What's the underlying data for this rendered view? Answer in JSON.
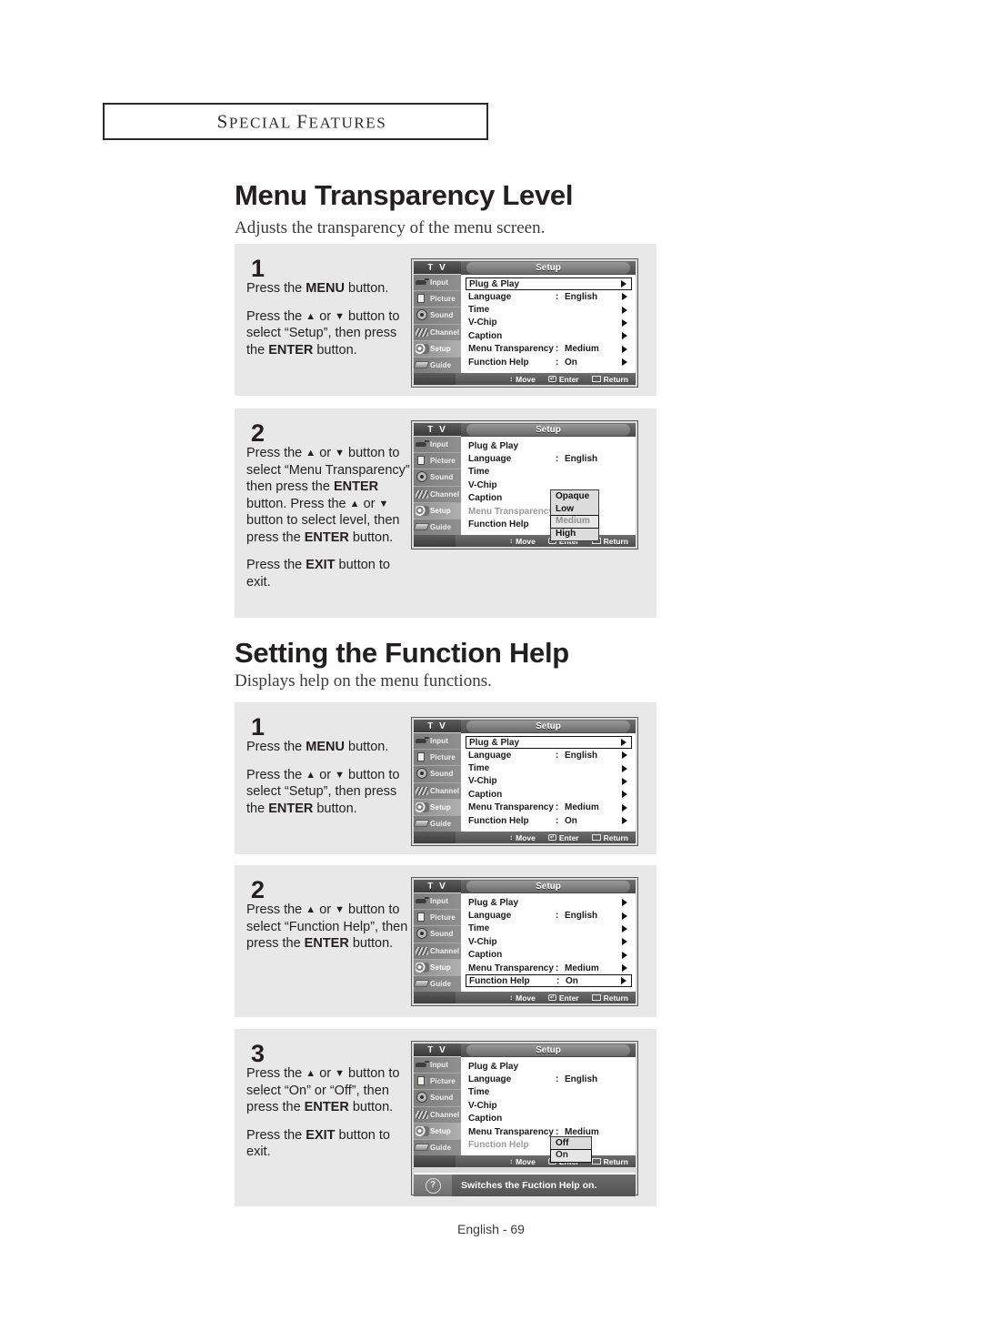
{
  "runhead": {
    "text": "SPECIAL FEATURES",
    "first": "S",
    "rest1": "PECIAL ",
    "second": "F",
    "rest2": "EATURES"
  },
  "footer": {
    "label": "English - 69"
  },
  "osd_common": {
    "tv_label": "T V",
    "title": "Setup",
    "sidebar": [
      {
        "label": "Input",
        "icon": "input-icon"
      },
      {
        "label": "Picture",
        "icon": "picture-icon"
      },
      {
        "label": "Sound",
        "icon": "sound-icon"
      },
      {
        "label": "Channel",
        "icon": "channel-icon"
      },
      {
        "label": "Setup",
        "icon": "setup-icon"
      },
      {
        "label": "Guide",
        "icon": "guide-icon"
      }
    ],
    "bottom": [
      {
        "label": "Move",
        "icon": "updown-arrows-icon"
      },
      {
        "label": "Enter",
        "icon": "enter-key-icon"
      },
      {
        "label": "Return",
        "icon": "return-key-icon"
      }
    ],
    "rows": {
      "plug_play": "Plug & Play",
      "language": "Language",
      "language_value": "English",
      "time": "Time",
      "vchip": "V-Chip",
      "caption": "Caption",
      "menu_transparency": "Menu Transparency",
      "menu_transparency_value": "Medium",
      "function_help": "Function Help",
      "function_help_value": "On",
      "colon": ":"
    }
  },
  "section1": {
    "title": "Menu Transparency Level",
    "subtitle": "Adjusts the transparency of the menu screen.",
    "step1": {
      "num": "1",
      "line1_a": "Press the ",
      "line1_b": "MENU",
      "line1_c": " button.",
      "line2_a": "Press the ",
      "line2_up": "▲",
      "line2_or": " or ",
      "line2_dn": "▼",
      "line2_b": " button",
      "line3": "to select “Setup”, then",
      "line4_a": "press the ",
      "line4_b": "ENTER",
      "line4_c": " button."
    },
    "step2": {
      "num": "2",
      "l1_a": "Press the ",
      "l1_up": "▲",
      "l1_or": " or ",
      "l1_dn": "▼",
      "l1_b": " button",
      "l2": "to select “Menu",
      "l3": "Transparency”, then press",
      "l4_a": "the ",
      "l4_b": "ENTER",
      "l4_c": " button.",
      "l5_a": "Press the ",
      "l5_up": "▲",
      "l5_or": " or ",
      "l5_dn": "▼",
      "l5_b": " button",
      "l6": "to select level, then press",
      "l7_a": "the ",
      "l7_b": "ENTER",
      "l7_c": " button.",
      "l8_a": "Press the ",
      "l8_b": "EXIT",
      "l8_c": " button to",
      "l9": "exit."
    },
    "transparency_options": [
      "Opaque",
      "Low",
      "Medium",
      "High"
    ],
    "transparency_selected": "Medium"
  },
  "section2": {
    "title": "Setting the Function Help",
    "subtitle": "Displays help on the menu functions.",
    "step1": {
      "num": "1",
      "line1_a": "Press the ",
      "line1_b": "MENU",
      "line1_c": " button.",
      "line2_a": "Press the ",
      "line2_up": "▲",
      "line2_or": " or ",
      "line2_dn": "▼",
      "line2_b": " button",
      "line3": "to select “Setup”, then",
      "line4_a": "press the ",
      "line4_b": "ENTER",
      "line4_c": " button."
    },
    "step2": {
      "num": "2",
      "l1_a": "Press the ",
      "l1_up": "▲",
      "l1_or": " or ",
      "l1_dn": "▼",
      "l1_b": " button",
      "l2": "to select “Function Help”,",
      "l3_a": "then press the ",
      "l3_b": "ENTER",
      "l4": "button."
    },
    "step3": {
      "num": "3",
      "l1_a": "Press the ",
      "l1_up": "▲",
      "l1_or": " or ",
      "l1_dn": "▼",
      "l1_b": " button",
      "l2": "to select “On” or “Off”,",
      "l3_a": "then press the ",
      "l3_b": "ENTER",
      "l4": "button.",
      "l5_a": "Press the ",
      "l5_b": "EXIT",
      "l5_c": " button to",
      "l6": "exit."
    },
    "help_options": [
      "Off",
      "On"
    ],
    "help_selected": "On",
    "help_bar_text": "Switches the Fuction Help on.",
    "help_bar_icon": "question-mark-icon"
  }
}
